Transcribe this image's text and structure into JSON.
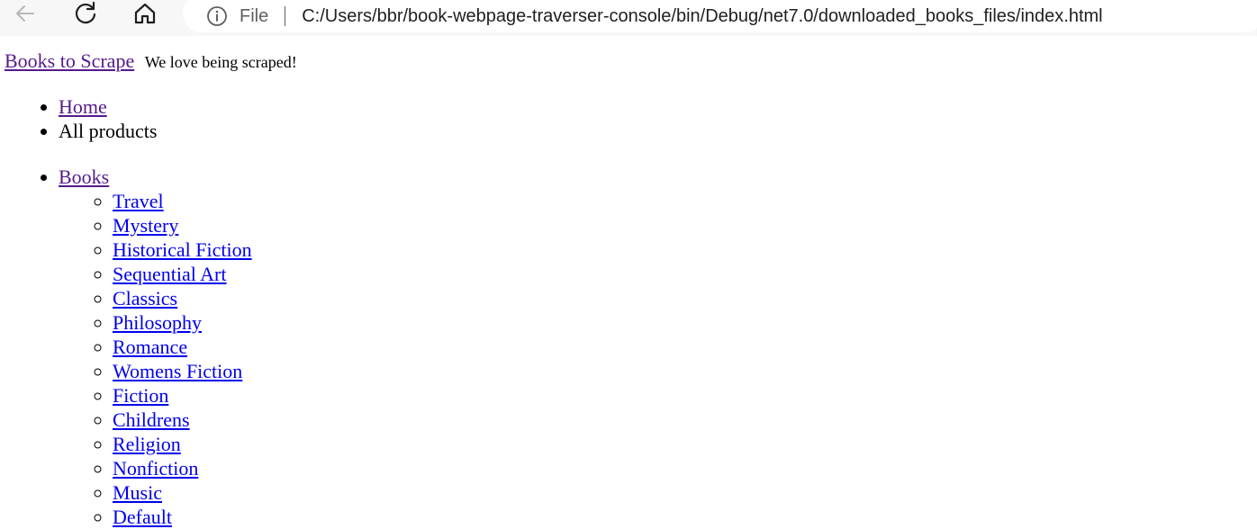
{
  "browser": {
    "address": {
      "scheme_label": "File",
      "url": "C:/Users/bbr/book-webpage-traverser-console/bin/Debug/net7.0/downloaded_books_files/index.html"
    },
    "icons": {
      "back": "back-arrow-icon",
      "reload": "reload-icon",
      "home": "home-icon",
      "info": "info-icon"
    }
  },
  "header": {
    "site_name": "Books to Scrape",
    "tagline": "We love being scraped!"
  },
  "breadcrumb": {
    "home": "Home",
    "current": "All products"
  },
  "categories": {
    "root": "Books",
    "items": [
      "Travel",
      "Mystery",
      "Historical Fiction",
      "Sequential Art",
      "Classics",
      "Philosophy",
      "Romance",
      "Womens Fiction",
      "Fiction",
      "Childrens",
      "Religion",
      "Nonfiction",
      "Music",
      "Default"
    ]
  },
  "colors": {
    "visited_link": "#551a8b",
    "link": "#0000ee",
    "toolbar_bg": "#f7f7f7"
  }
}
